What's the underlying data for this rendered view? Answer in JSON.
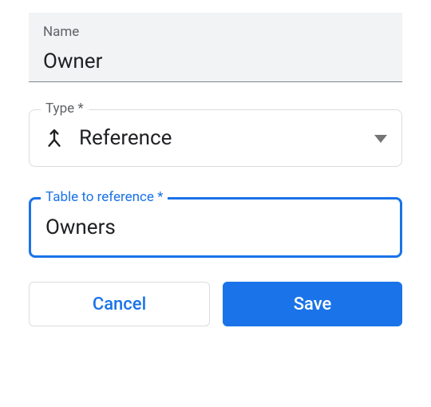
{
  "name_field": {
    "label": "Name",
    "value": "Owner"
  },
  "type_field": {
    "label": "Type *",
    "value": "Reference"
  },
  "table_ref_field": {
    "label": "Table to reference *",
    "value": "Owners"
  },
  "buttons": {
    "cancel": "Cancel",
    "save": "Save"
  }
}
